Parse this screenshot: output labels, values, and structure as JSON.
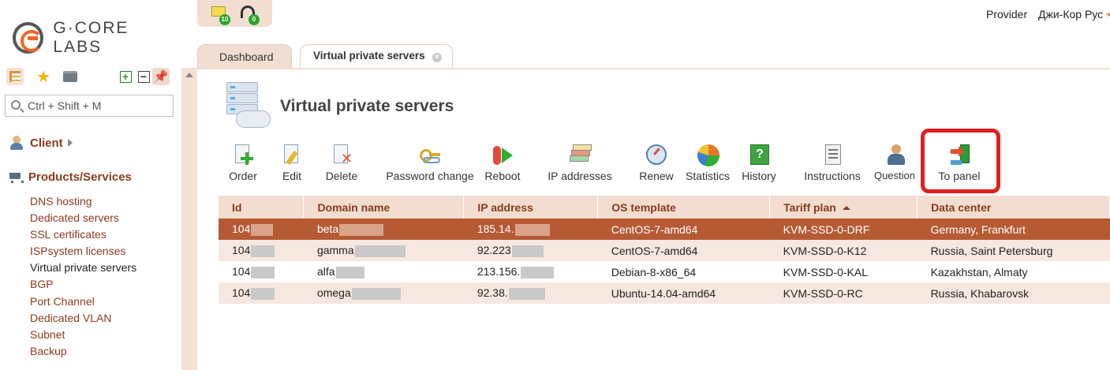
{
  "brand": {
    "name": "G·CORE LABS"
  },
  "sidebar": {
    "search_placeholder": "Ctrl + Shift + M",
    "client_label": "Client",
    "products_label": "Products/Services",
    "items": [
      {
        "label": "DNS hosting"
      },
      {
        "label": "Dedicated servers"
      },
      {
        "label": "SSL certificates"
      },
      {
        "label": "ISPsystem licenses"
      },
      {
        "label": "Virtual private servers",
        "active": true
      },
      {
        "label": "BGP"
      },
      {
        "label": "Port Channel"
      },
      {
        "label": "Dedicated VLAN"
      },
      {
        "label": "Subnet"
      },
      {
        "label": "Backup"
      }
    ]
  },
  "header": {
    "notifications": {
      "mail_count": "10",
      "support_count": "0"
    },
    "provider_label": "Provider",
    "user_label": "Джи-Кор Рус"
  },
  "tabs": [
    {
      "label": "Dashboard"
    },
    {
      "label": "Virtual private servers"
    }
  ],
  "page": {
    "title": "Virtual private servers"
  },
  "toolbar": {
    "order": "Order",
    "edit": "Edit",
    "delete": "Delete",
    "password_change": "Password change",
    "reboot": "Reboot",
    "ip_addresses": "IP addresses",
    "renew": "Renew",
    "statistics": "Statistics",
    "history": "History",
    "instructions": "Instructions",
    "question": "Question",
    "to_panel": "To panel"
  },
  "table": {
    "columns": [
      "Id",
      "Domain name",
      "IP address",
      "OS template",
      "Tariff plan",
      "Data center"
    ],
    "sorted_column": "Tariff plan",
    "rows": [
      {
        "id": "104",
        "domain": "beta",
        "ip": "185.14.",
        "os": "CentOS-7-amd64",
        "tariff": "KVM-SSD-0-DRF",
        "dc": "Germany, Frankfurt",
        "selected": true
      },
      {
        "id": "104",
        "domain": "gamma",
        "ip": "92.223",
        "os": "CentOS-7-amd64",
        "tariff": "KVM-SSD-0-K12",
        "dc": "Russia, Saint Petersburg"
      },
      {
        "id": "104",
        "domain": "alfa",
        "ip": "213.156.",
        "os": "Debian-8-x86_64",
        "tariff": "KVM-SSD-0-KAL",
        "dc": "Kazakhstan, Almaty"
      },
      {
        "id": "104",
        "domain": "omega",
        "ip": "92.38.",
        "os": "Ubuntu-14.04-amd64",
        "tariff": "KVM-SSD-0-RC",
        "dc": "Russia, Khabarovsk"
      }
    ]
  },
  "colors": {
    "accent": "#8b3a1e",
    "selected_row": "#b65a33",
    "highlight": "#e02020"
  }
}
